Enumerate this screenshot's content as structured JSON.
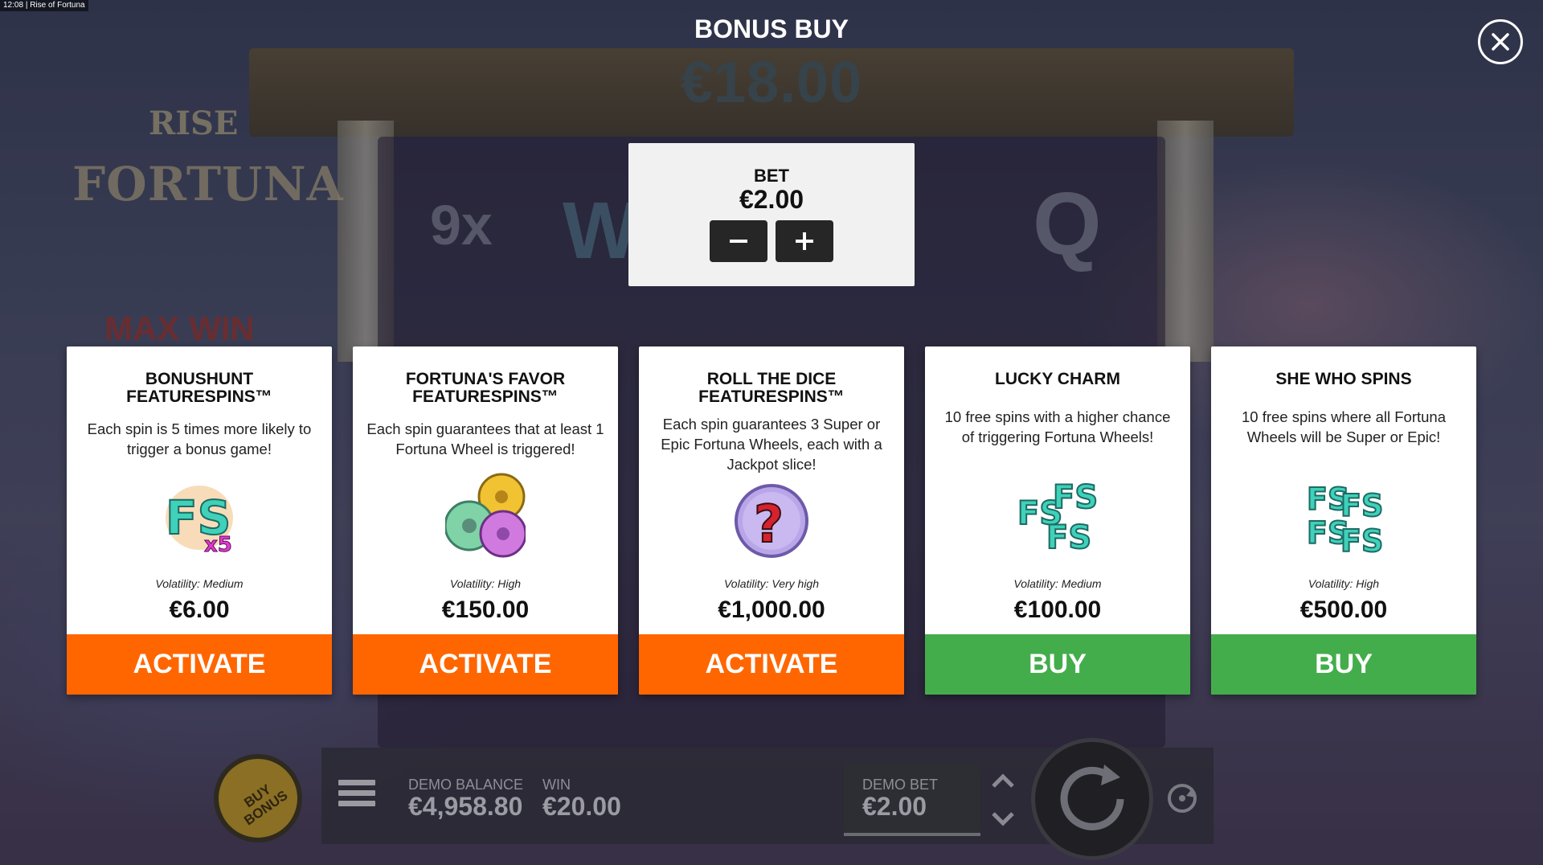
{
  "status_bar": {
    "time": "12:08",
    "separator": "|",
    "app_title": "Rise of Fortuna"
  },
  "background": {
    "logo_line1": "RISE",
    "logo_line2": "FORTUNA",
    "max_win_label": "MAX WIN",
    "symbols": [
      "9x",
      "W",
      "Q"
    ]
  },
  "header": {
    "title": "BONUS BUY",
    "total": "€18.00"
  },
  "bet": {
    "label": "BET",
    "value": "€2.00"
  },
  "cards": [
    {
      "title_line1": "BONUSHUNT",
      "title_line2": "FEATURESPINS™",
      "description": "Each spin is 5 times more likely to trigger a bonus game!",
      "icon": "fs-x5-icon",
      "icon_text": "FS",
      "icon_badge": "x5",
      "volatility": "Volatility: Medium",
      "price": "€6.00",
      "action": "ACTIVATE",
      "action_color": "#ff6600"
    },
    {
      "title_line1": "FORTUNA'S FAVOR",
      "title_line2": "FEATURESPINS™",
      "description": "Each spin guarantees that at least 1 Fortuna Wheel is triggered!",
      "icon": "fortuna-wheels-icon",
      "volatility": "Volatility: High",
      "price": "€150.00",
      "action": "ACTIVATE",
      "action_color": "#ff6600"
    },
    {
      "title_line1": "ROLL THE DICE",
      "title_line2": "FEATURESPINS™",
      "description": "Each spin guarantees 3 Super or Epic Fortuna Wheels, each with a Jackpot slice!",
      "icon": "mystery-question-icon",
      "icon_text": "?",
      "volatility": "Volatility: Very high",
      "price": "€1,000.00",
      "action": "ACTIVATE",
      "action_color": "#ff6600"
    },
    {
      "title_line1": "LUCKY CHARM",
      "title_line2": "",
      "description": "10 free spins with a higher chance of triggering Fortuna Wheels!",
      "icon": "fs-triple-icon",
      "icon_text": "FS",
      "volatility": "Volatility: Medium",
      "price": "€100.00",
      "action": "BUY",
      "action_color": "#44ad4b"
    },
    {
      "title_line1": "SHE WHO SPINS",
      "title_line2": "",
      "description": "10 free spins where all Fortuna Wheels will be Super or Epic!",
      "icon": "fs-quad-icon",
      "icon_text": "FS",
      "volatility": "Volatility: High",
      "price": "€500.00",
      "action": "BUY",
      "action_color": "#44ad4b"
    }
  ],
  "bottom_bar": {
    "buy_bonus_label": "BUY BONUS",
    "demo_balance_label": "DEMO BALANCE",
    "demo_balance_value": "€4,958.80",
    "win_label": "WIN",
    "win_value": "€20.00",
    "demo_bet_label": "DEMO BET",
    "demo_bet_value": "€2.00"
  },
  "colors": {
    "activate": "#ff6600",
    "buy": "#44ad4b",
    "card_bg": "#ffffff",
    "bet_buttons": "#262626"
  }
}
